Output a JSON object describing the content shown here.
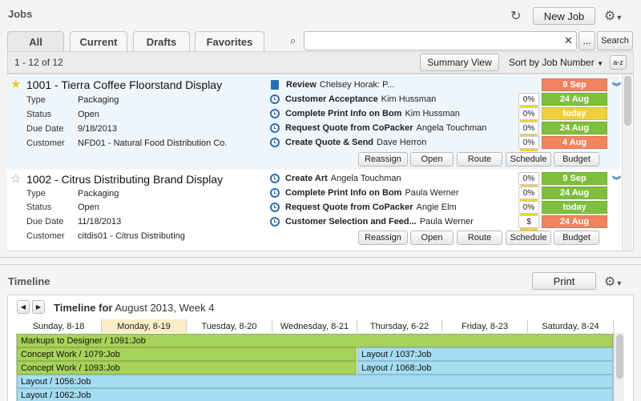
{
  "jobs_panel": {
    "title": "Jobs",
    "new_job_label": "New Job",
    "tabs": [
      {
        "label": "All"
      },
      {
        "label": "Current"
      },
      {
        "label": "Drafts"
      },
      {
        "label": "Favorites"
      }
    ],
    "search": {
      "placeholder": "",
      "value": "",
      "more_label": "...",
      "search_label": "Search"
    },
    "count_text": "1 - 12 of 12",
    "summary_view_label": "Summary View",
    "sort_label": "Sort by Job Number",
    "az_label": "a-z",
    "jobs": [
      {
        "title": "1001 - Tierra Coffee Floorstand Display",
        "starred": true,
        "fields": [
          {
            "label": "Type",
            "value": "Packaging"
          },
          {
            "label": "Status",
            "value": "Open"
          },
          {
            "label": "Due Date",
            "value": "9/18/2013"
          },
          {
            "label": "Customer",
            "value": "NFD01 - Natural Food Distribution Co."
          }
        ],
        "tasks": [
          {
            "name": "Review",
            "person": "Chelsey Horak: P...",
            "icon": "document-icon",
            "pct": "",
            "date": "9 Sep",
            "date_color": "#f1835e"
          },
          {
            "name": "Customer Acceptance",
            "person": "Kim Hussman",
            "icon": "clock-icon",
            "pct": "0%",
            "date": "24 Aug",
            "date_color": "#7fbf3d"
          },
          {
            "name": "Complete Print Info on Bom",
            "person": "Kim Hussman",
            "icon": "clock-icon",
            "pct": "0%",
            "date": "today",
            "date_color": "#f0d03c"
          },
          {
            "name": "Request Quote from CoPacker",
            "person": "Angela Touchman",
            "icon": "clock-icon",
            "pct": "0%",
            "date": "24 Aug",
            "date_color": "#7fbf3d"
          },
          {
            "name": "Create Quote & Send",
            "person": "Dave Herron",
            "icon": "clock-icon",
            "pct": "0%",
            "date": "4 Aug",
            "date_color": "#f1835e"
          }
        ],
        "actions": [
          "Reassign",
          "Open",
          "Route",
          "Schedule",
          "Budget"
        ]
      },
      {
        "title": "1002 - Citrus Distributing Brand Display",
        "starred": false,
        "fields": [
          {
            "label": "Type",
            "value": "Packaging"
          },
          {
            "label": "Status",
            "value": "Open"
          },
          {
            "label": "Due Date",
            "value": "11/18/2013"
          },
          {
            "label": "Customer",
            "value": "citdis01 - Citrus Distributing"
          }
        ],
        "tasks": [
          {
            "name": "Create Art",
            "person": "Angela Touchman",
            "icon": "clock-icon",
            "pct": "0%",
            "date": "9 Sep",
            "date_color": "#7fbf3d"
          },
          {
            "name": "Complete Print Info on Bom",
            "person": "Paula Werner",
            "icon": "clock-icon",
            "pct": "0%",
            "date": "24 Aug",
            "date_color": "#7fbf3d"
          },
          {
            "name": "Request Quote from CoPacker",
            "person": "Angie Elm",
            "icon": "clock-icon",
            "pct": "0%",
            "date": "today",
            "date_color": "#7fbf3d"
          },
          {
            "name": "Customer Selection and Feed...",
            "person": "Paula Werner",
            "icon": "clock-icon",
            "pct": "$",
            "date": "24 Aug",
            "date_color": "#f1835e"
          }
        ],
        "actions": [
          "Reassign",
          "Open",
          "Route",
          "Schedule",
          "Budget"
        ]
      }
    ]
  },
  "timeline_panel": {
    "title": "Timeline",
    "print_label": "Print",
    "heading_bold": "Timeline for",
    "heading_rest": "August 2013, Week 4",
    "days": [
      "Sunday, 8-18",
      "Monday, 8-19",
      "Tuesday, 8-20",
      "Wednesday, 8-21",
      "Thursday, 6-22",
      "Friday, 8-23",
      "Saturday, 8-24"
    ],
    "highlight_day": 1,
    "bars": [
      {
        "label": "Markups to Designer / 1091:Job",
        "color": "#a8d35a"
      },
      {
        "label": "Concept Work / 1079:Job",
        "color": "#a8d35a"
      },
      {
        "label": "Layout / 1037:Job",
        "color": "#a6ddf2"
      },
      {
        "label": "Concept Work / 1093:Job",
        "color": "#a8d35a"
      },
      {
        "label": "Layout / 1068:Job",
        "color": "#a6ddf2"
      },
      {
        "label": "Layout / 1056:Job",
        "color": "#a6ddf2"
      },
      {
        "label": "Layout / 1062:Job",
        "color": "#a6ddf2"
      }
    ]
  },
  "colors": {
    "accent": "#2a6fb5",
    "green": "#7fbf3d",
    "orange": "#f1835e",
    "yellow": "#f0d03c"
  }
}
